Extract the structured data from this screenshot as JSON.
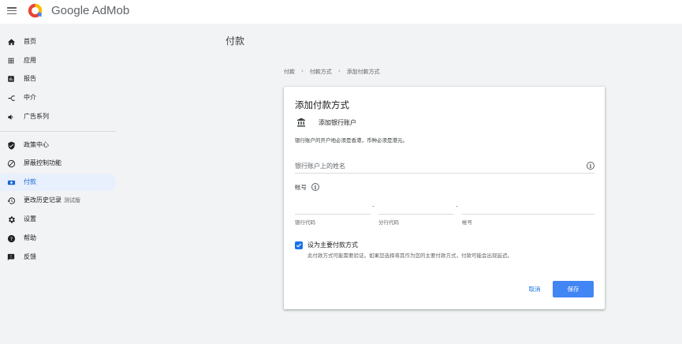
{
  "app": {
    "brand": "Google AdMob"
  },
  "sidebar": {
    "items": [
      {
        "label": "首页",
        "icon": "home-icon"
      },
      {
        "label": "应用",
        "icon": "apps-grid-icon"
      },
      {
        "label": "报告",
        "icon": "report-icon"
      },
      {
        "label": "中介",
        "icon": "mediation-icon"
      },
      {
        "label": "广告系列",
        "icon": "campaign-megaphone-icon"
      },
      {
        "label": "政策中心",
        "icon": "shield-icon"
      },
      {
        "label": "屏蔽控制功能",
        "icon": "block-icon"
      },
      {
        "label": "付款",
        "icon": "payments-icon",
        "active": true
      },
      {
        "label": "更改历史记录",
        "badge": "测试版",
        "icon": "history-icon"
      },
      {
        "label": "设置",
        "icon": "gear-icon"
      },
      {
        "label": "帮助",
        "icon": "help-icon"
      },
      {
        "label": "反馈",
        "icon": "feedback-icon"
      }
    ]
  },
  "page": {
    "title": "付款",
    "breadcrumb": [
      "付款",
      "付款方式",
      "添加付款方式"
    ]
  },
  "form": {
    "title": "添加付款方式",
    "method": "添加银行账户",
    "notice": "银行账户的开户地必须是香港，币种必须是港元。",
    "name_placeholder": "银行账户上的姓名",
    "account_label": "帐号",
    "bank_code_label": "银行代码",
    "branch_code_label": "分行代码",
    "account_no_label": "帐号",
    "separator": "-",
    "primary_checkbox_label": "设为主要付款方式",
    "primary_checkbox_checked": true,
    "primary_desc": "此付款方式可能需要验证。如果您选择将其作为您的主要付款方式，付款可能会出现延迟。",
    "cancel": "取消",
    "save": "保存"
  },
  "colors": {
    "accent": "#1a73e8",
    "save_button": "#4285f4",
    "active_nav_bg": "#e8f0fe"
  }
}
